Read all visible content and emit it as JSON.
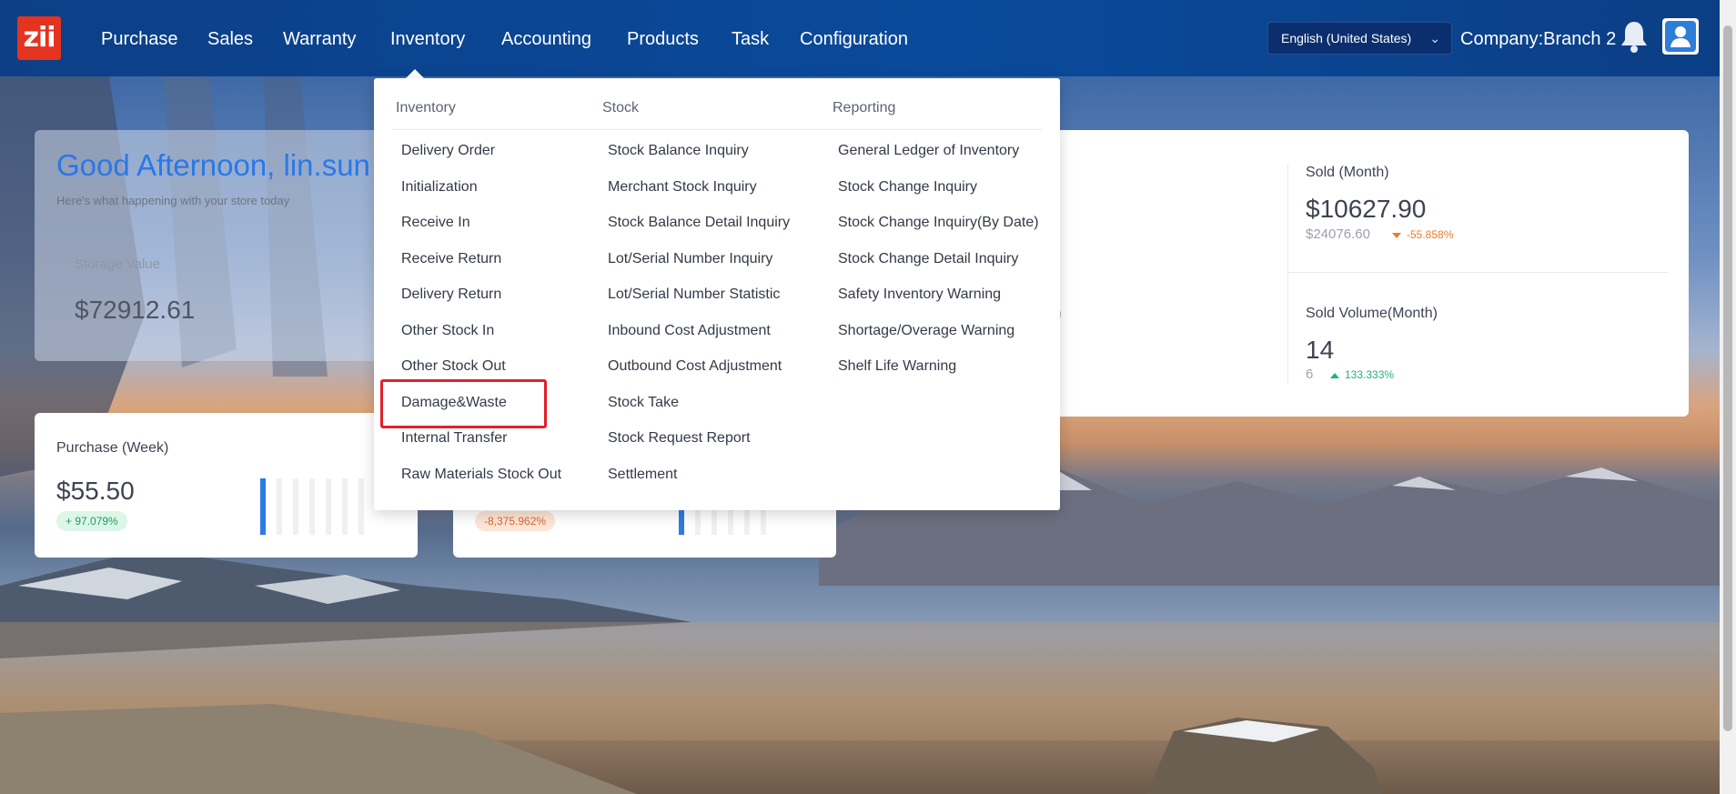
{
  "nav": {
    "logo": "zii",
    "items": [
      "Purchase",
      "Sales",
      "Warranty",
      "Inventory",
      "Accounting",
      "Products",
      "Task",
      "Configuration"
    ],
    "language": "English (United States)",
    "company": "Company:Branch 2"
  },
  "welcome": {
    "greeting": "Good Afternoon, lin.sun",
    "subtitle": "Here's what happening with your store today",
    "storage_label": "Storage Value",
    "storage_value": "$72912.61"
  },
  "stats": {
    "sold_month": {
      "title": "Sold (Month)",
      "value": "$10627.90",
      "previous": "$24076.60",
      "change": "-55.858%"
    },
    "sold_volume_month": {
      "title": "Sold Volume(Month)",
      "value": "14",
      "previous": "6",
      "change": "133.333%"
    },
    "partial_label": "th"
  },
  "week_cards": [
    {
      "title": "Purchase (Week)",
      "value": "$55.50",
      "change": "+ 97.079%"
    },
    {
      "title": "",
      "value": "",
      "change": "-8,375.962%"
    }
  ],
  "mega_menu": {
    "columns": [
      {
        "header": "Inventory",
        "items": [
          "Delivery Order",
          "Initialization",
          "Receive In",
          "Receive Return",
          "Delivery Return",
          "Other Stock In",
          "Other Stock Out",
          "Damage&Waste",
          "Internal Transfer",
          "Raw Materials Stock Out"
        ]
      },
      {
        "header": "Stock",
        "items": [
          "Stock Balance Inquiry",
          "Merchant Stock Inquiry",
          "Stock Balance Detail Inquiry",
          "Lot/Serial Number Inquiry",
          "Lot/Serial Number Statistic",
          "Inbound Cost Adjustment",
          "Outbound Cost Adjustment",
          "Stock Take",
          "Stock Request Report",
          "Settlement"
        ]
      },
      {
        "header": "Reporting",
        "items": [
          "General Ledger of Inventory",
          "Stock Change Inquiry",
          "Stock Change Inquiry(By Date)",
          "Stock Change Detail Inquiry",
          "Safety Inventory Warning",
          "Shortage/Overage Warning",
          "Shelf Life Warning"
        ]
      }
    ]
  },
  "colors": {
    "nav_bg": "#0a4a9c",
    "accent": "#2a78e8",
    "highlight": "#e2202c",
    "logo": "#e4331f",
    "up": "#22b573",
    "down": "#ef7a2a"
  }
}
